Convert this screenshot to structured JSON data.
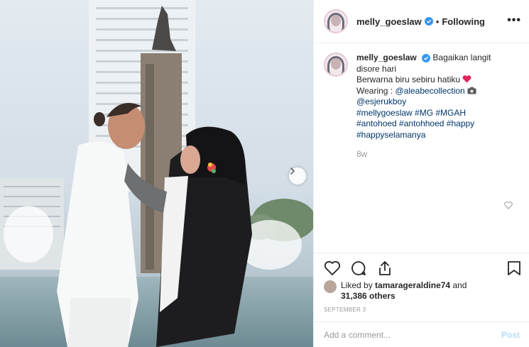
{
  "post": {
    "username": "melly_goeslaw",
    "verified": true,
    "follow_status": "Following",
    "more_icon": "more-horizontal-icon",
    "caption_lines": [
      "Bagaikan langit",
      "disore hari",
      "Berwarna biru sebiru hatiku",
      "Wearing : ",
      "@aleabecollection",
      "@esjerukboy",
      "#mellygoeslaw #MG #MGAH",
      "#antohoed #antohhoed #happy",
      "#happyselamanya"
    ],
    "time_ago": "8w",
    "liked_by_prefix": "Liked by",
    "liked_by_user": "tamarageraldine74",
    "liked_by_and": "and",
    "likes_count": "31,386 others",
    "date": "SEPTEMBER 3"
  },
  "comment": {
    "placeholder": "Add a comment...",
    "post_label": "Post"
  },
  "icons": {
    "like": "heart-icon",
    "comment": "comment-icon",
    "share": "share-icon",
    "save": "bookmark-icon",
    "next": "chevron-right-icon"
  },
  "colors": {
    "verified": "#3897f0",
    "link": "#003569",
    "heart_emoji": "#e0245e",
    "post_disabled": "#b2dffc"
  }
}
